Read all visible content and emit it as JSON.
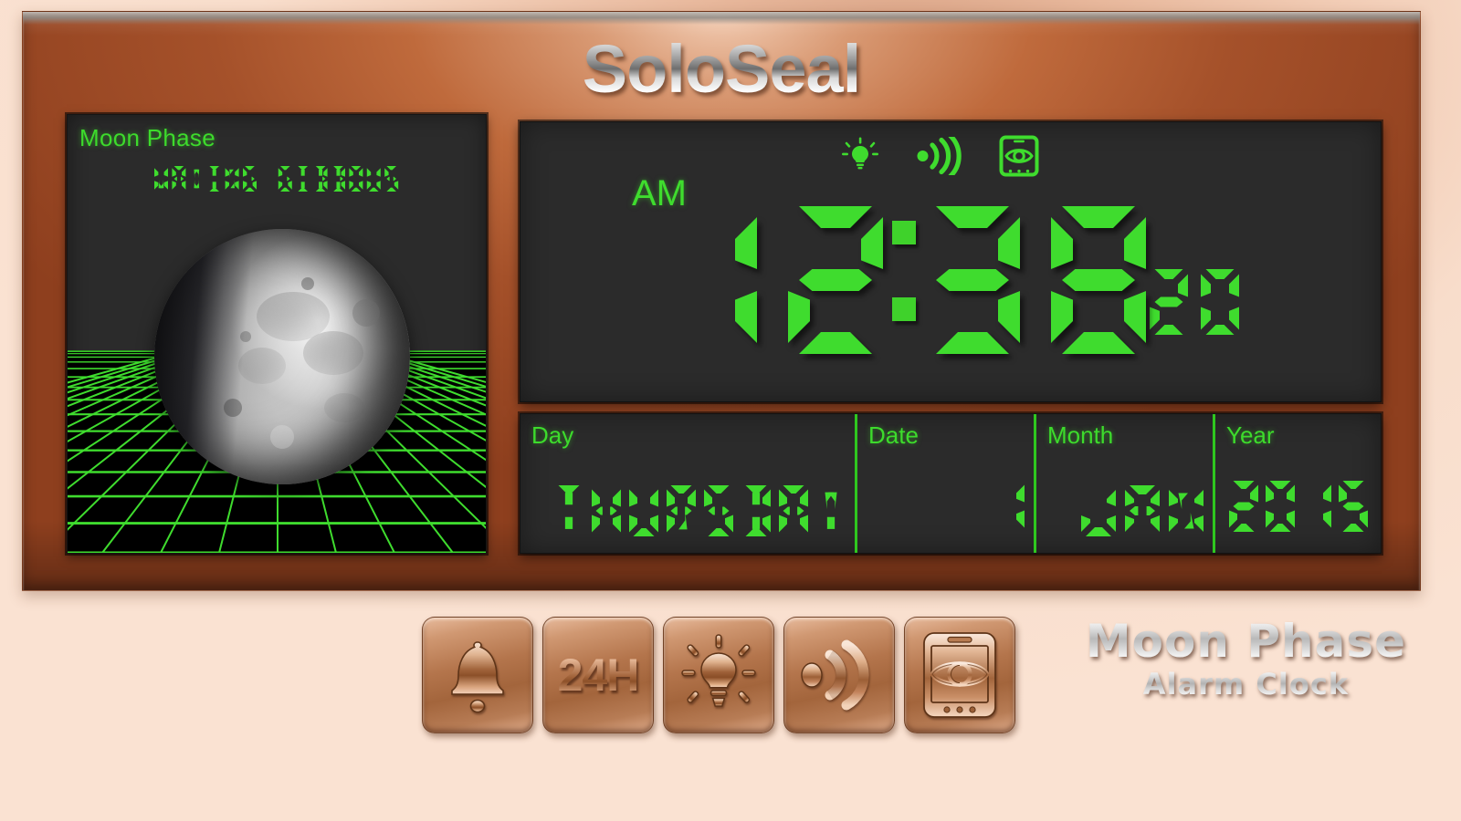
{
  "app": {
    "title": "SoloSeal",
    "logo_line1": "Moon Phase",
    "logo_line2": "Alarm Clock"
  },
  "colors": {
    "lcd_green": "#3fdc2e",
    "lcd_background": "#2b2b2b",
    "frame_copper": "#a5512a",
    "page_background": "#f2cdb6"
  },
  "moon_panel": {
    "label": "Moon Phase",
    "phase": "WAXING GIBBOUS"
  },
  "clock": {
    "meridiem": "AM",
    "hours": "12",
    "minutes": "38",
    "seconds": "20",
    "separator": ":",
    "status_icons": [
      {
        "name": "light-bulb-icon",
        "label": "Backlight"
      },
      {
        "name": "sound-wave-icon",
        "label": "Alarm sound"
      },
      {
        "name": "tablet-eye-icon",
        "label": "Night view"
      }
    ]
  },
  "date_panel": {
    "cells": [
      {
        "label": "Day",
        "value": "THURSDAY"
      },
      {
        "label": "Date",
        "value": "1"
      },
      {
        "label": "Month",
        "value": "JAN"
      },
      {
        "label": "Year",
        "value": "2015"
      }
    ]
  },
  "buttons": [
    {
      "name": "alarm-bell-button",
      "label": "",
      "icon": "bell-icon"
    },
    {
      "name": "24h-format-button",
      "label": "24H",
      "icon": "text-24h"
    },
    {
      "name": "backlight-button",
      "label": "",
      "icon": "light-bulb-icon"
    },
    {
      "name": "sound-button",
      "label": "",
      "icon": "sound-wave-icon"
    },
    {
      "name": "night-view-button",
      "label": "",
      "icon": "tablet-eye-icon"
    }
  ]
}
